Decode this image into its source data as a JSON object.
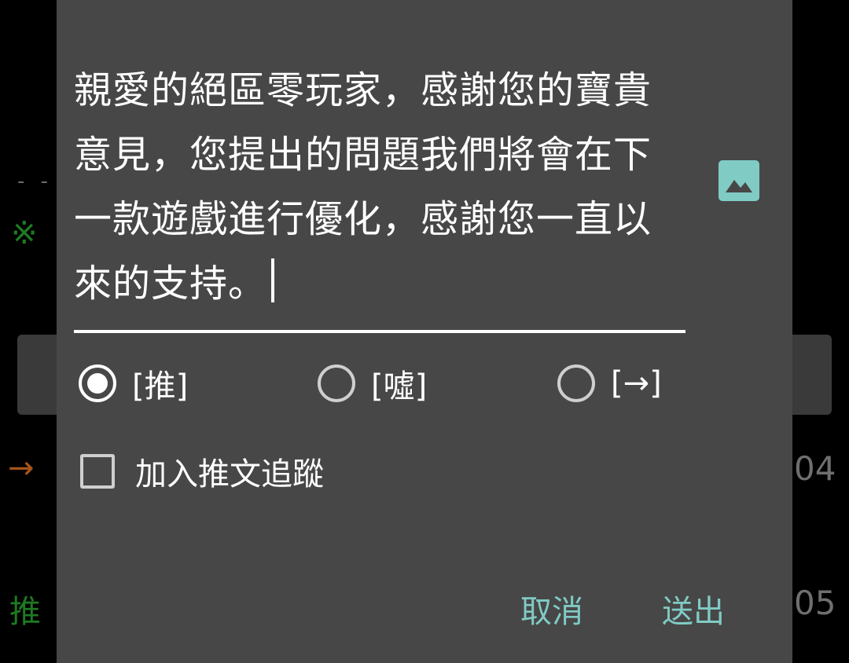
{
  "background": {
    "dash": "- -",
    "mark": "※",
    "arrow": "→",
    "push": "推",
    "number_1": "04",
    "number_2": "05"
  },
  "dialog": {
    "message_text": "親愛的絕區零玩家，感謝您的寶貴意見，您提出的問題我們將會在下一款遊戲進行優化，感謝您一直以來的支持。",
    "image_icon": "image-icon",
    "radio_options": [
      {
        "label": "[推]",
        "checked": true
      },
      {
        "label": "[噓]",
        "checked": false
      },
      {
        "label": "[→]",
        "checked": false
      }
    ],
    "checkbox": {
      "label": "加入推文追蹤",
      "checked": false
    },
    "cancel_label": "取消",
    "send_label": "送出"
  },
  "colors": {
    "dialog_background": "#474747",
    "accent": "#80cbc4",
    "image_icon": "#80cbc4"
  }
}
